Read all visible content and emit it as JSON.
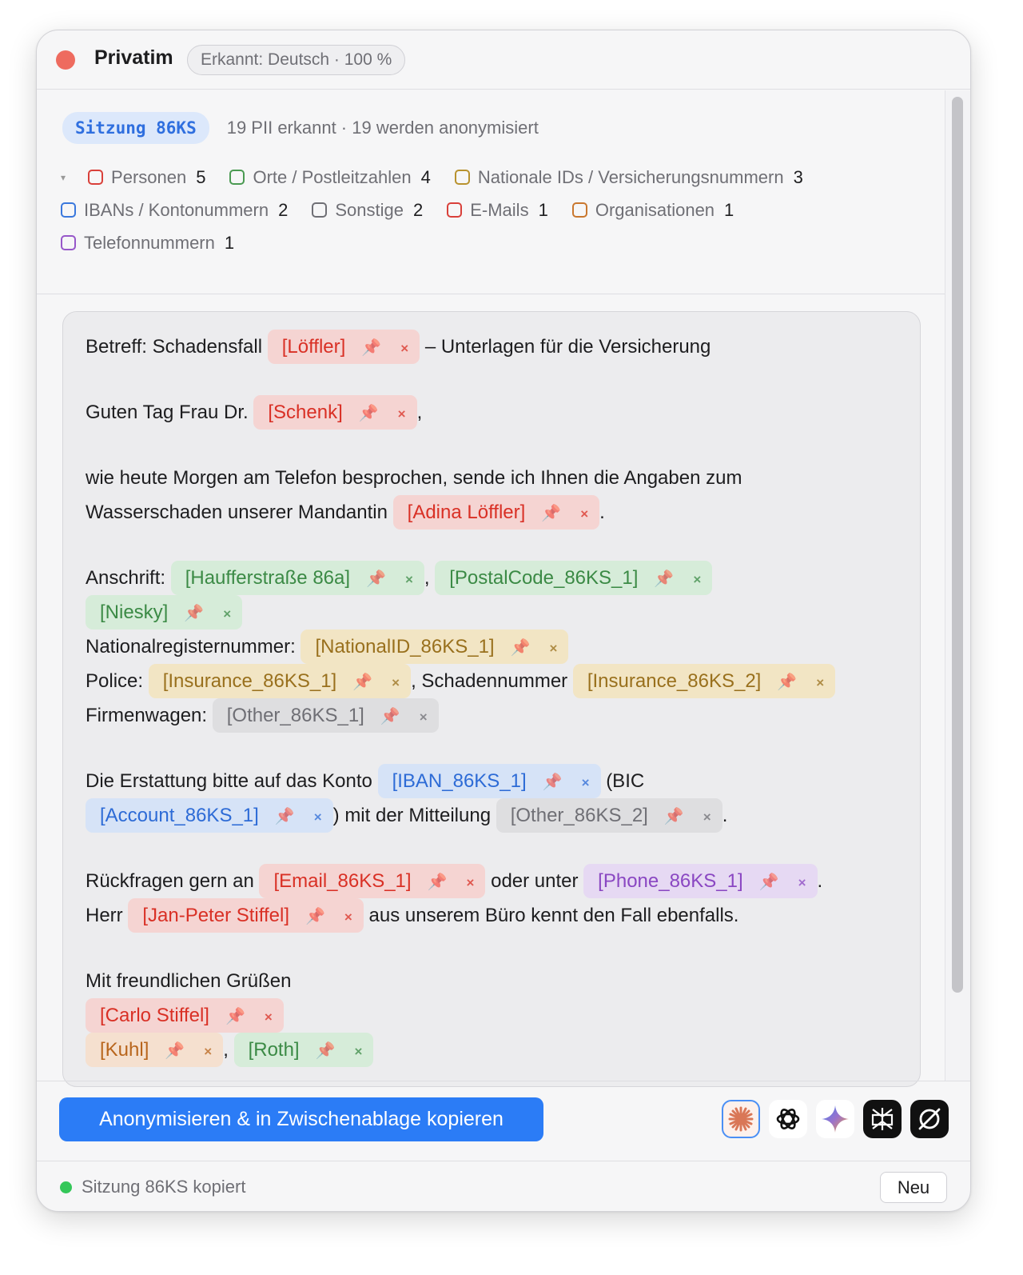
{
  "window": {
    "title": "Privatim",
    "language_badge": "Erkannt: Deutsch · 100 %"
  },
  "session": {
    "badge": "Sitzung 86KS",
    "summary": "19 PII erkannt · 19 werden anonymisiert"
  },
  "legend": {
    "toggle": "▾",
    "items": [
      {
        "label": "Personen",
        "count": "5",
        "color": "#d9403a"
      },
      {
        "label": "Orte / Postleitzahlen",
        "count": "4",
        "color": "#4a9a52"
      },
      {
        "label": "Nationale IDs / Versicherungsnummern",
        "count": "3",
        "color": "#b8922e"
      },
      {
        "label": "IBANs / Kontonummern",
        "count": "2",
        "color": "#3a78dd"
      },
      {
        "label": "Sonstige",
        "count": "2",
        "color": "#6f6f75"
      },
      {
        "label": "E-Mails",
        "count": "1",
        "color": "#d9403a"
      },
      {
        "label": "Organisationen",
        "count": "1",
        "color": "#c9772e"
      },
      {
        "label": "Telefonnummern",
        "count": "1",
        "color": "#9757c9"
      }
    ]
  },
  "editor": {
    "subject_prefix": "Betreff: Schadensfall",
    "subject_suffix": "– Unterlagen für die Versicherung",
    "greeting_prefix": "Guten Tag Frau Dr.",
    "greeting_suffix": ",",
    "body1": "wie heute Morgen am Telefon besprochen, sende ich Ihnen die Angaben zum",
    "body2": "Wasserschaden unserer Mandantin",
    "period": ".",
    "comma": ",",
    "address_label": "Anschrift:",
    "national_label": "Nationalregisternummer:",
    "police_label": "Police:",
    "claim_label": ", Schadennummer",
    "car_label": "Firmenwagen:",
    "refund_text": "Die Erstattung bitte auf das Konto",
    "bic_text": "(BIC",
    "message_text": ") mit der Mitteilung",
    "questions_text": "Rückfragen gern an",
    "or_text": "oder unter",
    "mr_text": "Herr",
    "office_text": "aus unserem Büro kennt den Fall ebenfalls.",
    "closing": "Mit freundlichen Grüßen",
    "tokens": {
      "loeffler": "[Löffler]",
      "schenk": "[Schenk]",
      "adina": "[Adina Löffler]",
      "street": "[Haufferstraße 86a]",
      "postal": "[PostalCode_86KS_1]",
      "city": "[Niesky]",
      "national": "[NationalID_86KS_1]",
      "ins1": "[Insurance_86KS_1]",
      "ins2": "[Insurance_86KS_2]",
      "other1": "[Other_86KS_1]",
      "iban": "[IBAN_86KS_1]",
      "account": "[Account_86KS_1]",
      "other2": "[Other_86KS_2]",
      "email": "[Email_86KS_1]",
      "phone": "[Phone_86KS_1]",
      "janpeter": "[Jan-Peter Stiffel]",
      "carlo": "[Carlo Stiffel]",
      "kuhl": "[Kuhl]",
      "roth": "[Roth]"
    },
    "pin_glyph": "📌",
    "remove_glyph": "×"
  },
  "actions": {
    "primary": "Anonymisieren & in Zwischenablage kopieren",
    "ai_icons": [
      "claude-icon",
      "chatgpt-icon",
      "gemini-icon",
      "perplexity-icon",
      "grok-icon"
    ]
  },
  "footer": {
    "status": "Sitzung 86KS kopiert",
    "new_button": "Neu"
  }
}
